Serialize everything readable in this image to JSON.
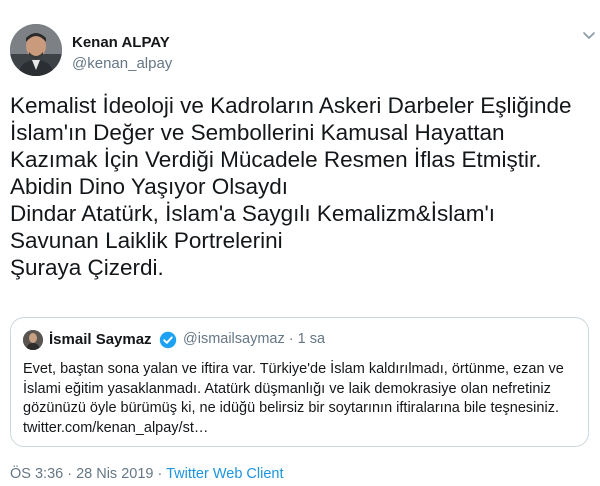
{
  "author": {
    "name": "Kenan ALPAY",
    "handle": "@kenan_alpay"
  },
  "tweet_lines": [
    "Kemalist İdeoloji ve Kadroların Askeri Darbeler Eşliğinde",
    "İslam'ın Değer ve Sembollerini Kamusal Hayattan",
    "Kazımak İçin Verdiği Mücadele Resmen İflas Etmiştir.",
    "Abidin Dino Yaşıyor Olsaydı",
    "Dindar Atatürk, İslam'a Saygılı Kemalizm&İslam'ı",
    "Savunan Laiklik Portrelerini",
    "Şuraya Çizerdi."
  ],
  "quoted": {
    "name": "İsmail Saymaz",
    "meta": "@ismailsaymaz · 1 sa",
    "lines": [
      "Evet, baştan sona yalan ve iftira var. Türkiye'de İslam kaldırılmadı, örtünme, ezan ve",
      "İslami eğitim yasaklanmadı. Atatürk düşmanlığı ve laik demokrasiye olan nefretiniz",
      "gözünüzü öyle bürümüş ki, ne idüğü belirsiz bir soytarının iftiralarına bile teşnesiniz.",
      "twitter.com/kenan_alpay/st…"
    ]
  },
  "footer": {
    "time": "ÖS 3:36 · 28 Nis 2019 · ",
    "client": "Twitter Web Client"
  },
  "colors": {
    "text": "#14171a",
    "secondary": "#657786",
    "link": "#1b95e0",
    "border": "#ccd6dd"
  },
  "icons": [
    "avatar-photo",
    "chevron-down-icon",
    "verified-badge-icon"
  ]
}
